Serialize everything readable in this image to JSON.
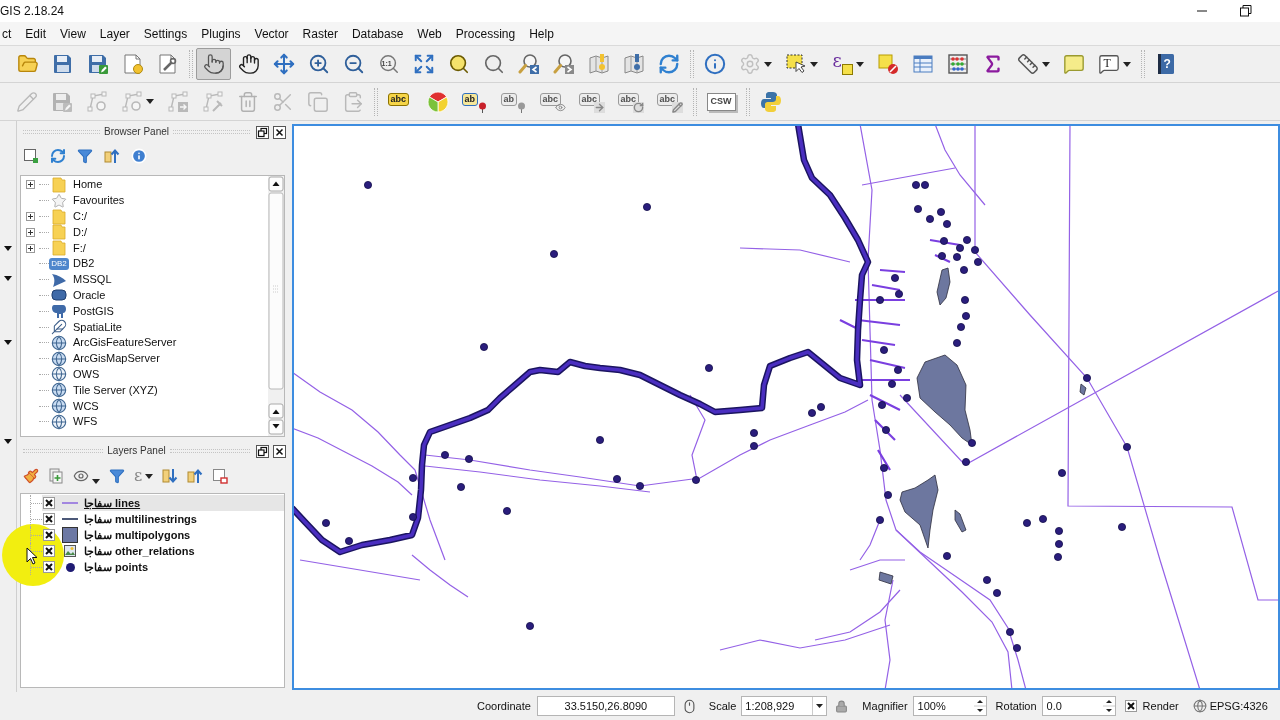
{
  "window": {
    "title": "GIS 2.18.24"
  },
  "menu_bar": [
    "ct",
    "Edit",
    "View",
    "Layer",
    "Settings",
    "Plugins",
    "Vector",
    "Raster",
    "Database",
    "Web",
    "Processing",
    "Help"
  ],
  "map_toolbar": [
    {
      "selected": false,
      "disabled": false
    },
    {
      "selected": false,
      "disabled": false
    },
    {
      "selected": false,
      "disabled": false
    },
    {
      "selected": false,
      "disabled": false
    },
    {
      "selected": false,
      "disabled": false
    },
    {
      "selected": true,
      "disabled": false
    },
    {
      "selected": false,
      "disabled": false
    },
    {
      "selected": false,
      "disabled": false
    },
    {
      "selected": false,
      "disabled": false
    },
    {
      "selected": false,
      "disabled": false
    },
    {
      "selected": false,
      "disabled": false,
      "text": "1:1"
    },
    {
      "selected": false,
      "disabled": false
    },
    {
      "selected": false,
      "disabled": false
    },
    {
      "selected": false,
      "disabled": false
    },
    {
      "selected": false,
      "disabled": false
    },
    {
      "selected": false,
      "disabled": false
    },
    {
      "selected": false,
      "disabled": false
    },
    {
      "selected": false,
      "disabled": false
    },
    {
      "selected": false,
      "disabled": false
    },
    {
      "selected": false,
      "disabled": false
    },
    {
      "selected": false,
      "disabled": true
    },
    {
      "selected": false,
      "disabled": false
    },
    {
      "selected": false,
      "disabled": false,
      "text": "ε"
    },
    {
      "selected": false,
      "disabled": false
    },
    {
      "selected": false,
      "disabled": false
    },
    {
      "selected": false,
      "disabled": false
    },
    {
      "selected": false,
      "disabled": false
    },
    {
      "selected": false,
      "disabled": false
    },
    {
      "selected": false,
      "disabled": false
    },
    {
      "selected": false,
      "disabled": false,
      "text": "T"
    },
    {
      "selected": false,
      "disabled": false,
      "text": "?"
    }
  ],
  "edit_toolbar": [
    {
      "disabled": true
    },
    {
      "disabled": true
    },
    {
      "disabled": true
    },
    {
      "disabled": true
    },
    {
      "disabled": true
    },
    {
      "disabled": true
    },
    {
      "disabled": true
    },
    {
      "disabled": true
    },
    {
      "disabled": true
    },
    {
      "disabled": true
    },
    {
      "disabled": false,
      "text": "abc"
    },
    {
      "disabled": false
    },
    {
      "disabled": false,
      "text": "ab"
    },
    {
      "disabled": true,
      "text": "ab"
    },
    {
      "disabled": true,
      "text": "abc"
    },
    {
      "disabled": true,
      "text": "abc"
    },
    {
      "disabled": true,
      "text": "abc"
    },
    {
      "disabled": true,
      "text": "abc"
    },
    {
      "disabled": false,
      "text": "CSW"
    },
    {
      "disabled": false
    }
  ],
  "browser_panel": {
    "title": "Browser Panel",
    "items": [
      {
        "label": "Home",
        "expandable": true
      },
      {
        "label": "Favourites",
        "expandable": false
      },
      {
        "label": "C:/",
        "expandable": true
      },
      {
        "label": "D:/",
        "expandable": true
      },
      {
        "label": "F:/",
        "expandable": true
      },
      {
        "label": "DB2",
        "expandable": false,
        "icon_text": "DB2"
      },
      {
        "label": "MSSQL",
        "expandable": false
      },
      {
        "label": "Oracle",
        "expandable": false
      },
      {
        "label": "PostGIS",
        "expandable": false
      },
      {
        "label": "SpatiaLite",
        "expandable": false
      },
      {
        "label": "ArcGisFeatureServer",
        "expandable": false
      },
      {
        "label": "ArcGisMapServer",
        "expandable": false
      },
      {
        "label": "OWS",
        "expandable": false
      },
      {
        "label": "Tile Server (XYZ)",
        "expandable": false
      },
      {
        "label": "WCS",
        "expandable": false
      },
      {
        "label": "WFS",
        "expandable": false
      }
    ]
  },
  "layers_panel": {
    "title": "Layers Panel",
    "expression_button": {
      "text": "ε"
    },
    "layers": [
      {
        "name": "سفاجا lines",
        "kind": "line",
        "checked": true,
        "selected": true,
        "color": "#a286e0"
      },
      {
        "name": "سفاجا multilinestrings",
        "kind": "line",
        "checked": true,
        "selected": false,
        "color": "#4b5878"
      },
      {
        "name": "سفاجا multipolygons",
        "kind": "polygon",
        "checked": true,
        "selected": false,
        "color": "#6c78a4"
      },
      {
        "name": "سفاجا other_relations",
        "kind": "raster",
        "checked": true,
        "selected": false
      },
      {
        "name": "سفاجا points",
        "kind": "point",
        "checked": true,
        "selected": false,
        "color": "#1f1b73"
      }
    ]
  },
  "status_bar": {
    "coordinate": {
      "label": "Coordinate",
      "value": "33.5150,26.8090"
    },
    "scale": {
      "label": "Scale",
      "value": "1:208,929"
    },
    "magnifier": {
      "label": "Magnifier",
      "value": "100%"
    },
    "rotation": {
      "label": "Rotation",
      "value": "0.0"
    },
    "render": {
      "label": "Render",
      "checked": true
    },
    "crs": "EPSG:4326"
  }
}
